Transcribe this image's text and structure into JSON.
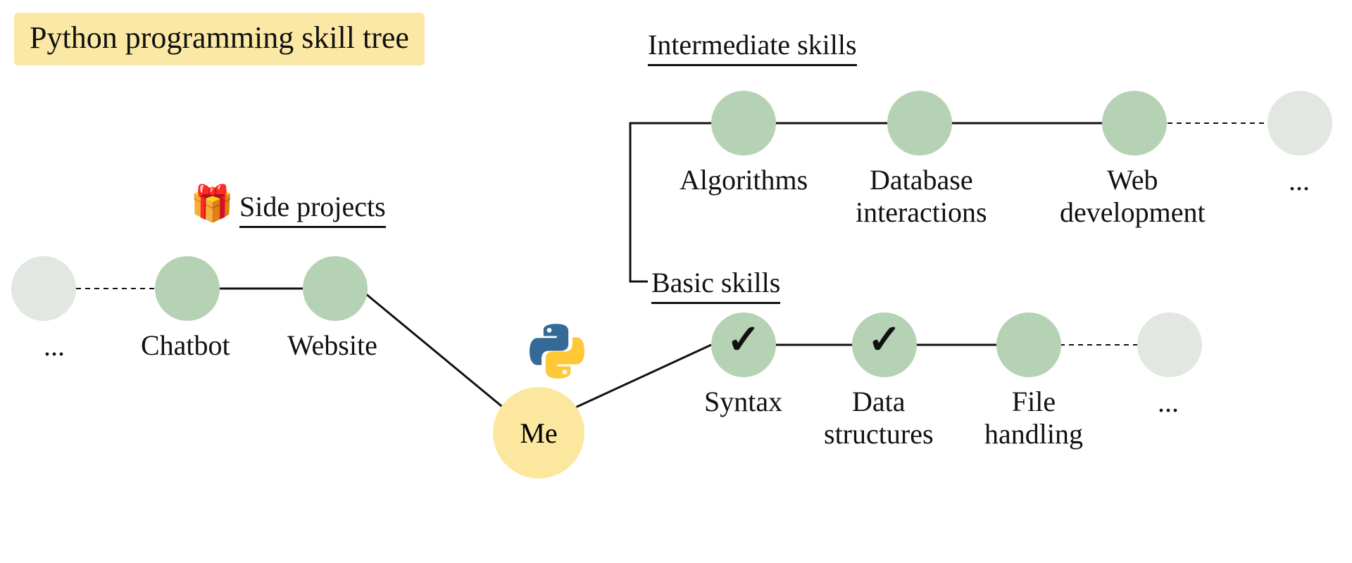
{
  "title": "Python programming skill tree",
  "me_label": "Me",
  "headings": {
    "side_projects": "Side projects",
    "basic_skills": "Basic skills",
    "intermediate_skills": "Intermediate skills"
  },
  "side_projects": [
    {
      "name": "Chatbot",
      "completed": false
    },
    {
      "name": "Website",
      "completed": false
    }
  ],
  "basic_skills": [
    {
      "name": "Syntax",
      "completed": true
    },
    {
      "name": "Data\nstructures",
      "completed": true
    },
    {
      "name": "File\nhandling",
      "completed": false
    }
  ],
  "intermediate_skills": [
    {
      "name": "Algorithms",
      "completed": false
    },
    {
      "name": "Database\ninteractions",
      "completed": false
    },
    {
      "name": "Web\ndevelopment",
      "completed": false
    }
  ],
  "ellipsis": "...",
  "icons": {
    "gift": "gift-icon",
    "python": "python-logo-icon",
    "check": "check-icon"
  },
  "colors": {
    "highlight": "#fbe8a5",
    "node_green": "#b6d2b4",
    "node_gray": "#e2e7e2",
    "node_yellow": "#fbe79e"
  }
}
